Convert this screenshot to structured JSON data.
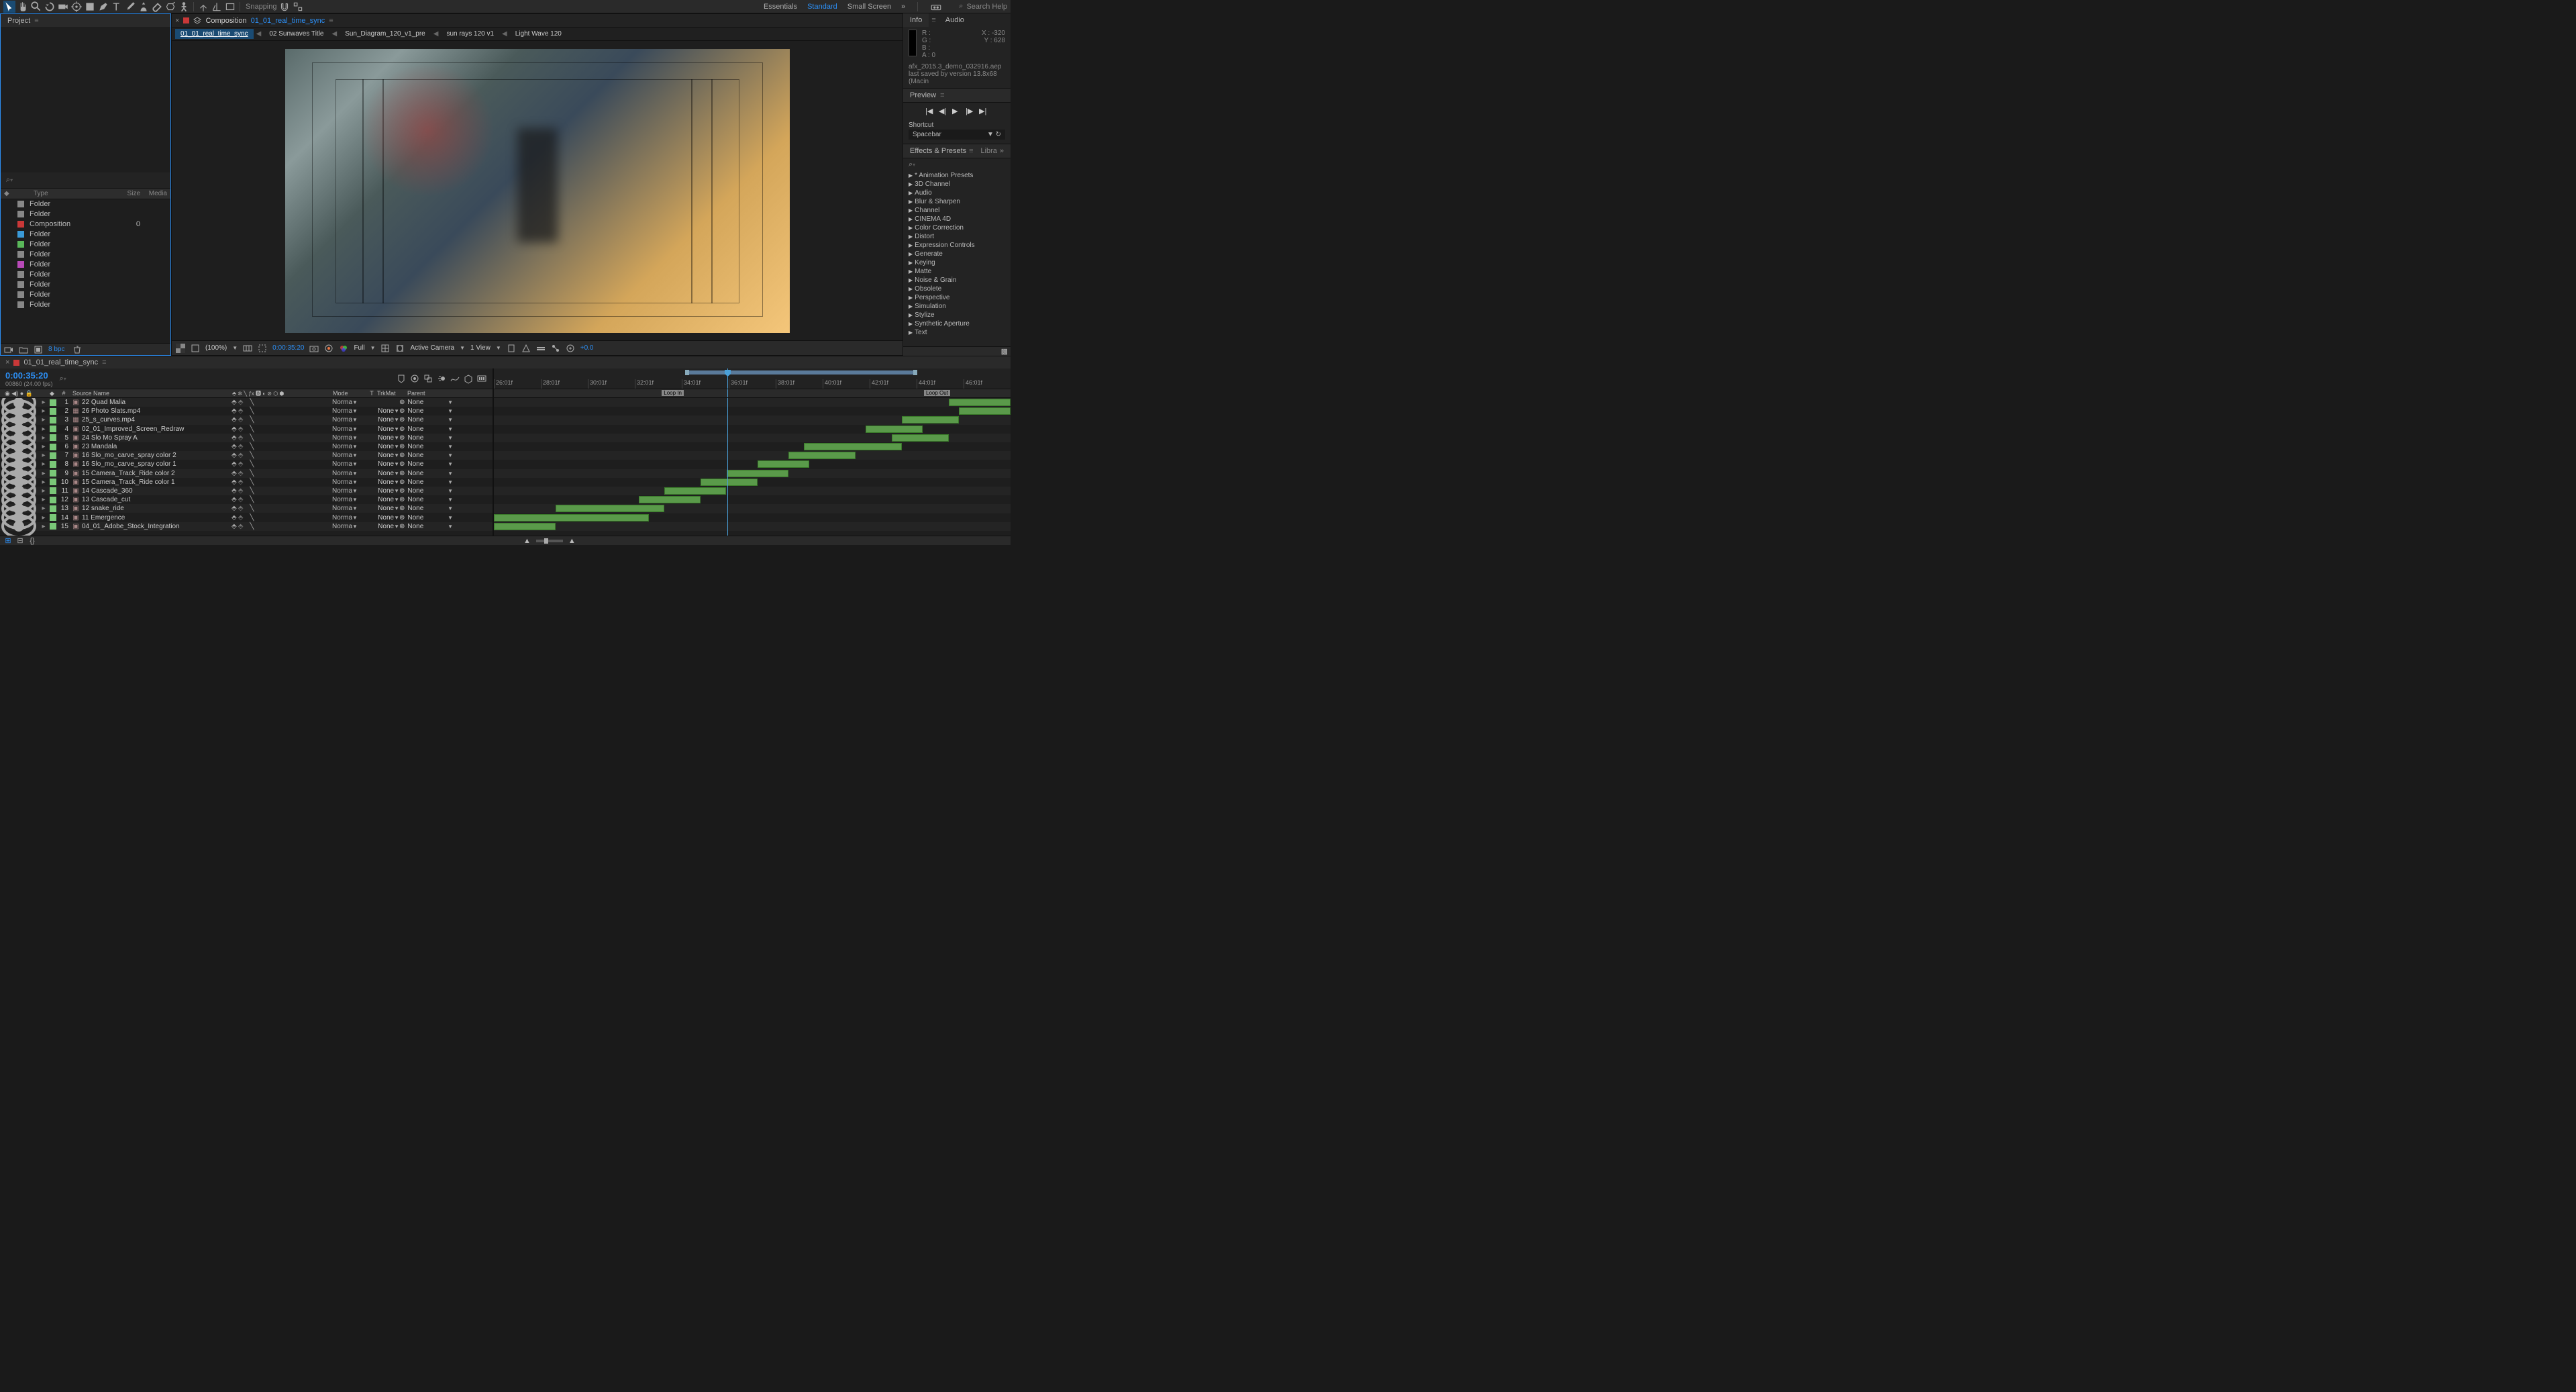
{
  "toolbar": {
    "snapping": "Snapping",
    "workspaces": [
      "Essentials",
      "Standard",
      "Small Screen"
    ],
    "active_workspace": 1,
    "search_placeholder": "Search Help"
  },
  "project": {
    "tab": "Project",
    "search": "⌕",
    "cols": {
      "type": "Type",
      "size": "Size",
      "media": "Media"
    },
    "items": [
      {
        "color": "#888",
        "type": "Folder",
        "size": ""
      },
      {
        "color": "#888",
        "type": "Folder",
        "size": ""
      },
      {
        "color": "#c93838",
        "type": "Composition",
        "size": "0"
      },
      {
        "color": "#3a9ad8",
        "type": "Folder",
        "size": ""
      },
      {
        "color": "#5ab85a",
        "type": "Folder",
        "size": ""
      },
      {
        "color": "#888",
        "type": "Folder",
        "size": ""
      },
      {
        "color": "#b84ab8",
        "type": "Folder",
        "size": ""
      },
      {
        "color": "#888",
        "type": "Folder",
        "size": ""
      },
      {
        "color": "#888",
        "type": "Folder",
        "size": ""
      },
      {
        "color": "#888",
        "type": "Folder",
        "size": ""
      },
      {
        "color": "#888",
        "type": "Folder",
        "size": ""
      }
    ],
    "bpc": "8 bpc"
  },
  "comp": {
    "label": "Composition",
    "name": "01_01_real_time_sync",
    "flow": [
      "01_01_real_time_sync",
      "02 Sunwaves Title",
      "Sun_Diagram_120_v1_pre",
      "sun rays 120 v1",
      "Light Wave 120"
    ]
  },
  "viewer_footer": {
    "zoom": "(100%)",
    "time": "0:00:35:20",
    "res": "Full",
    "camera": "Active Camera",
    "view": "1 View",
    "exposure": "+0.0"
  },
  "info": {
    "tabs": [
      "Info",
      "Audio"
    ],
    "r": "R :",
    "g": "G :",
    "b": "B :",
    "a": "A :  0",
    "x": "X : -320",
    "y": "Y :  628",
    "file": "afx_2015.3_demo_032916.aep",
    "saved": "last saved by version 13.8x68 (Macin"
  },
  "preview": {
    "tab": "Preview",
    "shortcut_label": "Shortcut",
    "shortcut_val": "Spacebar"
  },
  "effects": {
    "tabs": [
      "Effects & Presets",
      "Libra"
    ],
    "items": [
      "* Animation Presets",
      "3D Channel",
      "Audio",
      "Blur & Sharpen",
      "Channel",
      "CINEMA 4D",
      "Color Correction",
      "Distort",
      "Expression Controls",
      "Generate",
      "Keying",
      "Matte",
      "Noise & Grain",
      "Obsolete",
      "Perspective",
      "Simulation",
      "Stylize",
      "Synthetic Aperture",
      "Text"
    ]
  },
  "timeline": {
    "tab_name": "01_01_real_time_sync",
    "timecode": "0:00:35:20",
    "frames": "00860 (24.00 fps)",
    "cols": {
      "source": "Source Name",
      "mode": "Mode",
      "t": "T",
      "trkmat": "TrkMat",
      "parent": "Parent"
    },
    "ticks": [
      "26:01f",
      "28:01f",
      "30:01f",
      "32:01f",
      "34:01f",
      "36:01f",
      "38:01f",
      "40:01f",
      "42:01f",
      "44:01f",
      "46:01f"
    ],
    "loop_in": "Loop In",
    "loop_out": "Loop Out",
    "mode_val": "Norma",
    "trk_val": "None",
    "par_val": "None",
    "layers": [
      {
        "n": 1,
        "name": "22 Quad Malia",
        "color": "#7ac878",
        "ico": "▣",
        "start": 88,
        "end": 100
      },
      {
        "n": 2,
        "name": "26 Photo Slats.mp4",
        "color": "#7ac878",
        "ico": "▦",
        "start": 90,
        "end": 100
      },
      {
        "n": 3,
        "name": "25_s_curves.mp4",
        "color": "#7ac878",
        "ico": "▦",
        "start": 79,
        "end": 90
      },
      {
        "n": 4,
        "name": "02_01_Improved_Screen_Redraw",
        "color": "#7ac878",
        "ico": "▣",
        "start": 72,
        "end": 83
      },
      {
        "n": 5,
        "name": "24 Slo Mo Spray A",
        "color": "#7ac878",
        "ico": "▣",
        "start": 77,
        "end": 88
      },
      {
        "n": 6,
        "name": "23 Mandala",
        "color": "#7ac878",
        "ico": "▣",
        "start": 60,
        "end": 79
      },
      {
        "n": 7,
        "name": "16 Slo_mo_carve_spray color 2",
        "color": "#7ac878",
        "ico": "▣",
        "start": 57,
        "end": 70
      },
      {
        "n": 8,
        "name": "16 Slo_mo_carve_spray color 1",
        "color": "#7ac878",
        "ico": "▣",
        "start": 51,
        "end": 61
      },
      {
        "n": 9,
        "name": "15 Camera_Track_Ride color 2",
        "color": "#7ac878",
        "ico": "▣",
        "start": 45,
        "end": 57
      },
      {
        "n": 10,
        "name": "15 Camera_Track_Ride color 1",
        "color": "#7ac878",
        "ico": "▣",
        "start": 40,
        "end": 51
      },
      {
        "n": 11,
        "name": "14 Cascade_360",
        "color": "#7ac878",
        "ico": "▣",
        "start": 33,
        "end": 45
      },
      {
        "n": 12,
        "name": "13 Cascade_cut",
        "color": "#7ac878",
        "ico": "▣",
        "start": 28,
        "end": 40
      },
      {
        "n": 13,
        "name": "12 snake_ride",
        "color": "#7ac878",
        "ico": "▣",
        "start": 12,
        "end": 33
      },
      {
        "n": 14,
        "name": "11 Emergence",
        "color": "#7ac878",
        "ico": "▣",
        "start": 0,
        "end": 30
      },
      {
        "n": 15,
        "name": "04_01_Adobe_Stock_Integration",
        "color": "#7ac878",
        "ico": "▣",
        "start": 0,
        "end": 12
      }
    ]
  }
}
